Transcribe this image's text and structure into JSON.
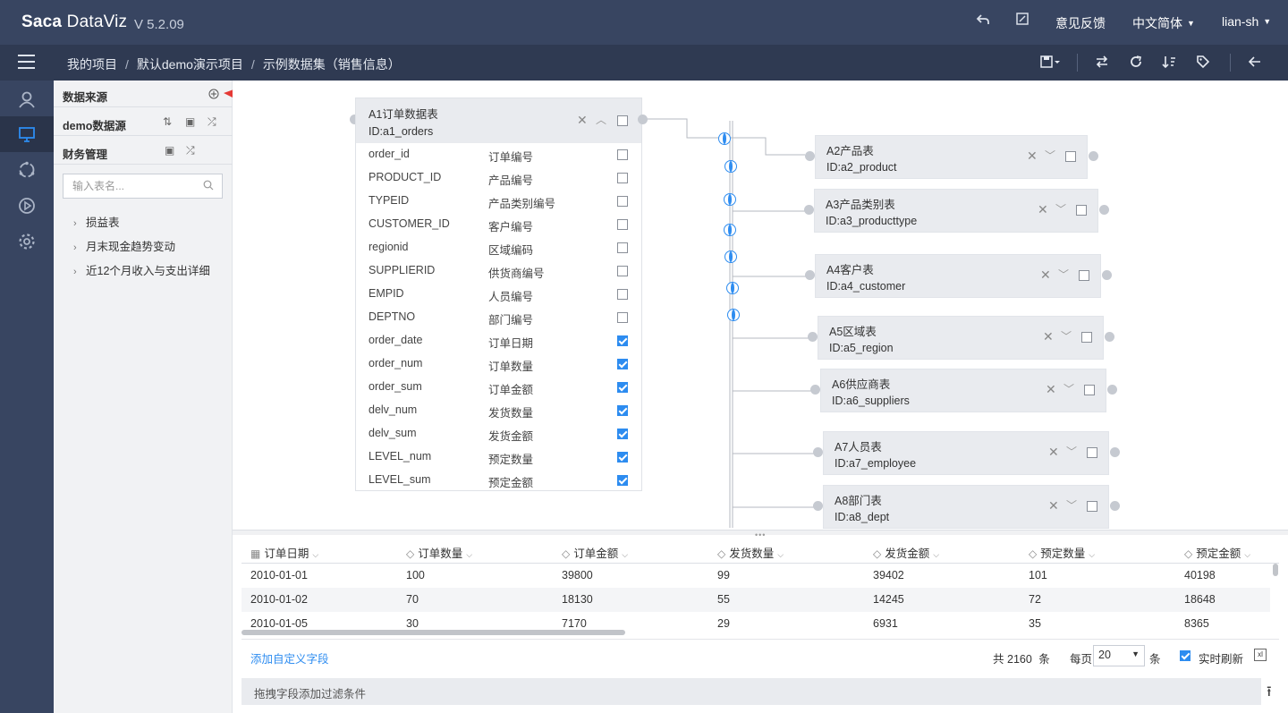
{
  "app": {
    "logo_a": "Saca",
    "logo_b": "DataViz",
    "version": "V 5.2.09"
  },
  "topbar": {
    "feedback": "意见反馈",
    "language": "中文简体",
    "user": "lian-sh"
  },
  "breadcrumb": {
    "items": [
      "我的项目",
      "默认demo演示项目",
      "示例数据集（销售信息）"
    ],
    "sep": "/"
  },
  "panel": {
    "data_source_title": "数据来源",
    "group1": "demo数据源",
    "group2": "财务管理",
    "search_placeholder": "输入表名...",
    "tree": [
      "损益表",
      "月末现金趋势变动",
      "近12个月收入与支出详细"
    ]
  },
  "main_table": {
    "name": "A1订单数据表",
    "id": "ID:a1_orders",
    "fields": [
      {
        "field": "order_id",
        "label": "订单编号",
        "checked": false
      },
      {
        "field": "PRODUCT_ID",
        "label": "产品编号",
        "checked": false
      },
      {
        "field": "TYPEID",
        "label": "产品类别编号",
        "checked": false
      },
      {
        "field": "CUSTOMER_ID",
        "label": "客户编号",
        "checked": false
      },
      {
        "field": "regionid",
        "label": "区域编码",
        "checked": false
      },
      {
        "field": "SUPPLIERID",
        "label": "供货商编号",
        "checked": false
      },
      {
        "field": "EMPID",
        "label": "人员编号",
        "checked": false
      },
      {
        "field": "DEPTNO",
        "label": "部门编号",
        "checked": false
      },
      {
        "field": "order_date",
        "label": "订单日期",
        "checked": true
      },
      {
        "field": "order_num",
        "label": "订单数量",
        "checked": true
      },
      {
        "field": "order_sum",
        "label": "订单金额",
        "checked": true
      },
      {
        "field": "delv_num",
        "label": "发货数量",
        "checked": true
      },
      {
        "field": "delv_sum",
        "label": "发货金额",
        "checked": true
      },
      {
        "field": "LEVEL_num",
        "label": "预定数量",
        "checked": true
      },
      {
        "field": "LEVEL_sum",
        "label": "预定金额",
        "checked": true
      }
    ]
  },
  "joined_tables": [
    {
      "name": "A2产品表",
      "id": "ID:a2_product"
    },
    {
      "name": "A3产品类别表",
      "id": "ID:a3_producttype"
    },
    {
      "name": "A4客户表",
      "id": "ID:a4_customer"
    },
    {
      "name": "A5区域表",
      "id": "ID:a5_region"
    },
    {
      "name": "A6供应商表",
      "id": "ID:a6_suppliers"
    },
    {
      "name": "A7人员表",
      "id": "ID:a7_employee"
    },
    {
      "name": "A8部门表",
      "id": "ID:a8_dept"
    }
  ],
  "grid": {
    "columns": [
      "订单日期",
      "订单数量",
      "订单金额",
      "发货数量",
      "发货金额",
      "预定数量",
      "预定金额"
    ],
    "rows": [
      [
        "2010-01-01",
        "100",
        "39800",
        "99",
        "39402",
        "101",
        "40198"
      ],
      [
        "2010-01-02",
        "70",
        "18130",
        "55",
        "14245",
        "72",
        "18648"
      ],
      [
        "2010-01-05",
        "30",
        "7170",
        "29",
        "6931",
        "35",
        "8365"
      ]
    ]
  },
  "footer": {
    "add_field": "添加自定义字段",
    "total_prefix": "共",
    "total": "2160",
    "total_unit": "条",
    "per_page_label": "每页",
    "per_page": "20",
    "per_page_unit": "条",
    "realtime_refresh": "实时刷新",
    "realtime_checked": true,
    "filter_hint": "拖拽字段添加过滤条件"
  },
  "colors": {
    "topbar": "#384561",
    "subbar": "#2f3a52",
    "accent": "#2d8cf0",
    "annotation_arrow": "#e53935"
  }
}
